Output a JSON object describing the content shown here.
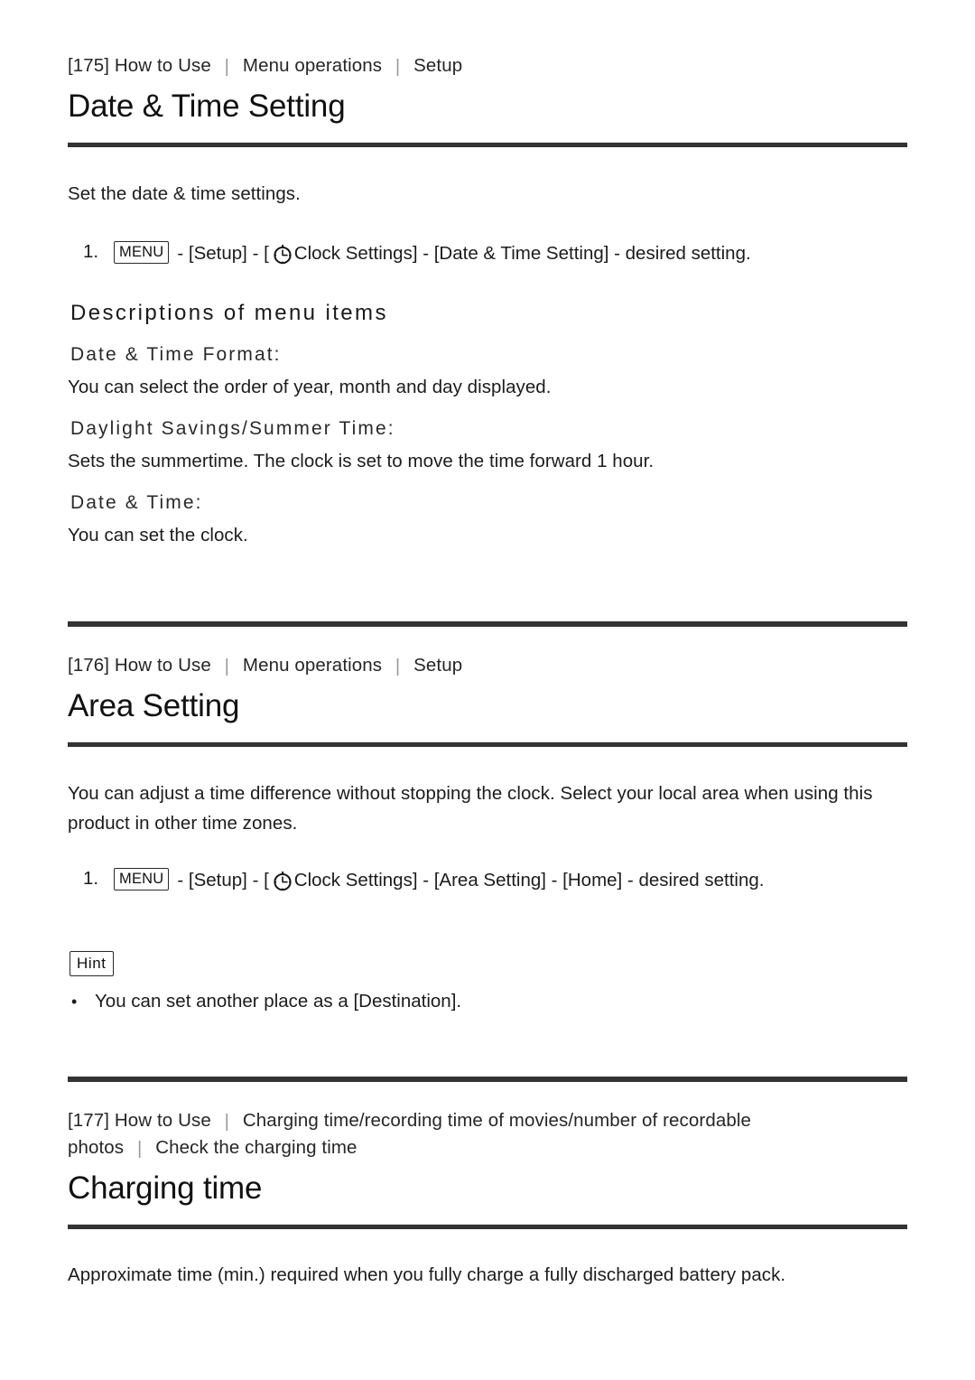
{
  "document": {
    "background_color": "#ffffff",
    "text_color": "#1c1c1c",
    "rule_color": "#333333"
  },
  "icons": {
    "clock": "clock-icon",
    "menu_button": "MENU",
    "hint_label": "Hint",
    "breadcrumb_separator": "|",
    "bullet": "•"
  },
  "sections": [
    {
      "id": "date-time-setting",
      "breadcrumb": {
        "index": "[175]",
        "crumbs": [
          "How to Use",
          "Menu operations",
          "Setup"
        ]
      },
      "title": "Date & Time Setting",
      "intro": "Set the date & time settings.",
      "step": {
        "number": "1.",
        "menu_label": "MENU",
        "before_icon": "- [Setup] - [",
        "after_icon": "Clock Settings] - [Date & Time Setting] - desired setting."
      },
      "descriptions_heading": "Descriptions of menu items",
      "items": [
        {
          "label": "Date & Time Format:",
          "text": "You can select the order of year, month and day displayed."
        },
        {
          "label": "Daylight Savings/Summer Time:",
          "text": "Sets the summertime. The clock is set to move the time forward 1 hour."
        },
        {
          "label": "Date & Time:",
          "text": "You can set the clock."
        }
      ]
    },
    {
      "id": "area-setting",
      "breadcrumb": {
        "index": "[176]",
        "crumbs": [
          "How to Use",
          "Menu operations",
          "Setup"
        ]
      },
      "title": "Area Setting",
      "intro": "You can adjust a time difference without stopping the clock. Select your local area when using this product in other time zones.",
      "step": {
        "number": "1.",
        "menu_label": "MENU",
        "before_icon": "- [Setup] - [",
        "after_icon": "Clock Settings] - [Area Setting] - [Home] - desired setting."
      },
      "hint": {
        "label": "Hint",
        "bullets": [
          "You can set another place as a [Destination]."
        ]
      }
    },
    {
      "id": "charging-time",
      "breadcrumb": {
        "index": "[177]",
        "crumbs": [
          "How to Use",
          "Charging time/recording time of movies/number of recordable photos",
          "Check the charging time"
        ]
      },
      "title": "Charging time",
      "intro": "Approximate time (min.) required when you fully charge a fully discharged battery pack."
    }
  ]
}
